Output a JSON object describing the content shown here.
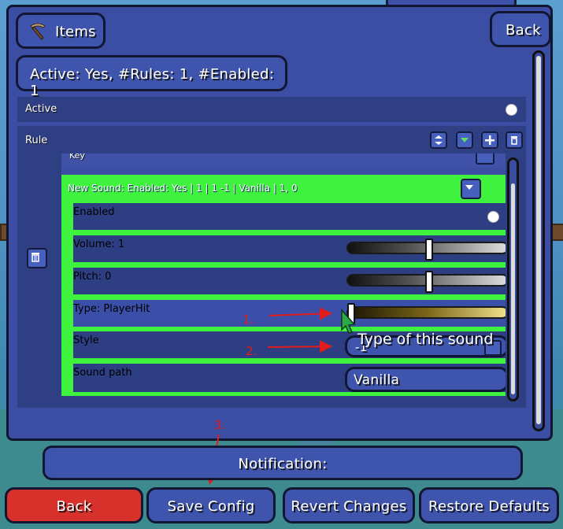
{
  "header": {
    "items_button_label": "Items",
    "back_button_label": "Back",
    "status_text": "Active: Yes, #Rules: 1, #Enabled: 1"
  },
  "config": {
    "active_label": "Active",
    "rule_label": "Rule",
    "key_label": "Key",
    "sound_header": "New Sound: Enabled: Yes | 1 | 1 -1 | Vanilla | 1, 0",
    "fields": {
      "enabled_label": "Enabled",
      "volume_label": "Volume: 1",
      "pitch_label": "Pitch: 0",
      "type_label": "Type: PlayerHit",
      "style_label": "Style",
      "style_value": "-1",
      "sound_path_label": "Sound path",
      "sound_path_value": "Vanilla"
    },
    "sliders": {
      "volume_level": 0.5,
      "pitch_level": 0.5,
      "type_level": 0.0
    }
  },
  "tooltip": "Type of this sound",
  "annotations": {
    "step1": "1.",
    "step2": "2.",
    "step3": "3."
  },
  "notification_label": "Notification:",
  "footer": {
    "back_label": "Back",
    "save_label": "Save Config",
    "revert_label": "Revert Changes",
    "restore_label": "Restore Defaults"
  },
  "colors": {
    "panel": "#3b4ea3",
    "green_highlight": "#3ef23e",
    "back_button_red": "#d8302a",
    "annotation_red": "#e21b1b"
  }
}
